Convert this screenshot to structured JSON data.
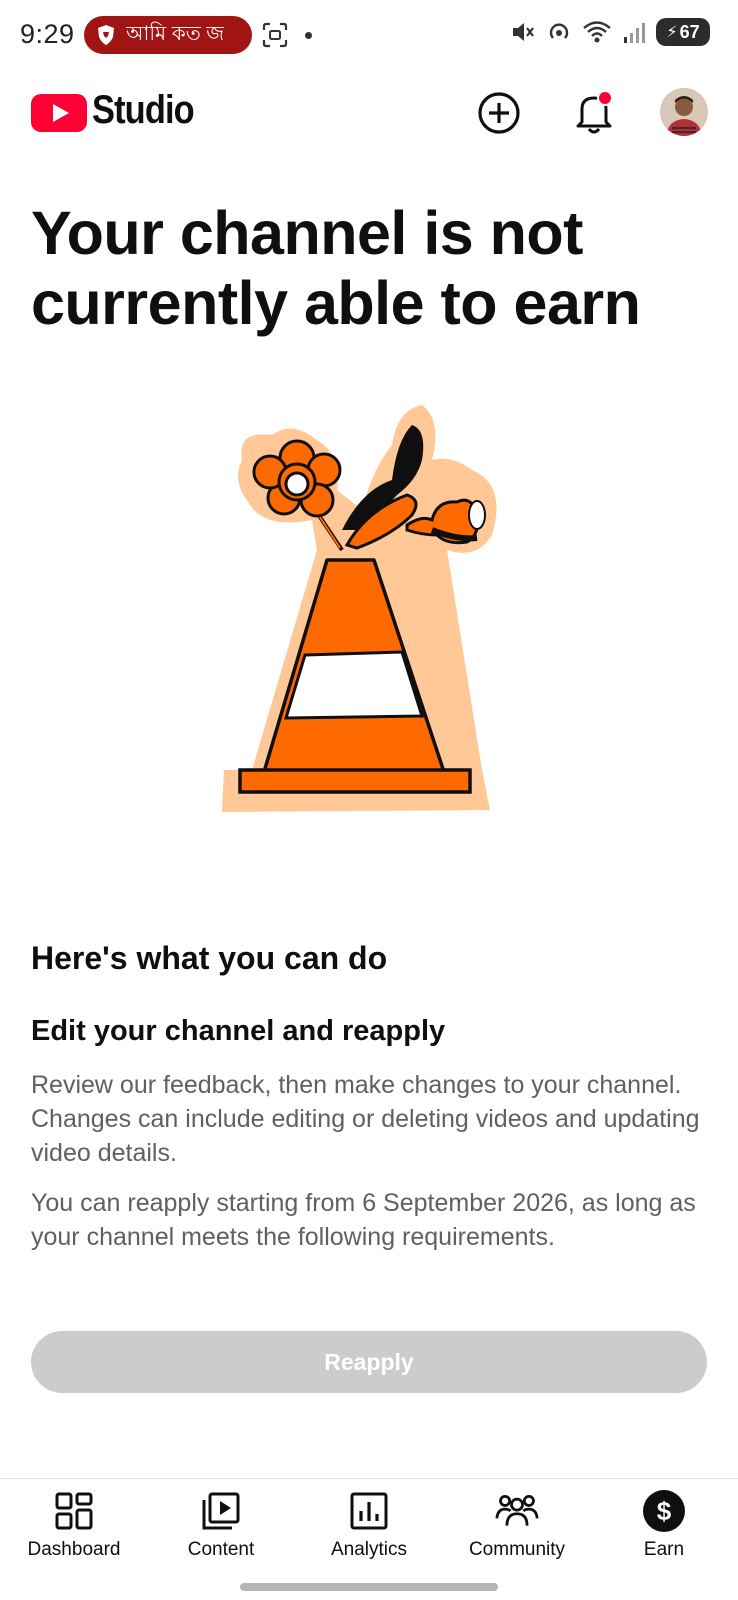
{
  "status_bar": {
    "time": "9:29",
    "notification_pill_text": "আমি কত জ",
    "battery_level": "67"
  },
  "app_bar": {
    "logo_text": "Studio"
  },
  "main": {
    "title": "Your channel is not currently able to earn",
    "section_heading": "Here's what you can do",
    "sub_heading": "Edit your channel and reapply",
    "paragraph_1": "Review our feedback, then make changes to your channel. Changes can include editing or deleting videos and updating video details.",
    "paragraph_2": "You can reapply starting from 6 September 2026, as long as your channel meets the following requirements.",
    "reapply_label": "Reapply"
  },
  "bottom_nav": {
    "items": [
      {
        "label": "Dashboard",
        "icon": "dashboard-icon"
      },
      {
        "label": "Content",
        "icon": "content-icon"
      },
      {
        "label": "Analytics",
        "icon": "analytics-icon"
      },
      {
        "label": "Community",
        "icon": "community-icon"
      },
      {
        "label": "Earn",
        "icon": "earn-icon"
      }
    ],
    "active": "Earn"
  },
  "colors": {
    "brand_red": "#ff0033",
    "pill_red": "#a01414",
    "cone_orange": "#ff6a00",
    "cone_halo": "#ffc896",
    "disabled_button": "#cccccc",
    "body_gray": "#606060"
  }
}
